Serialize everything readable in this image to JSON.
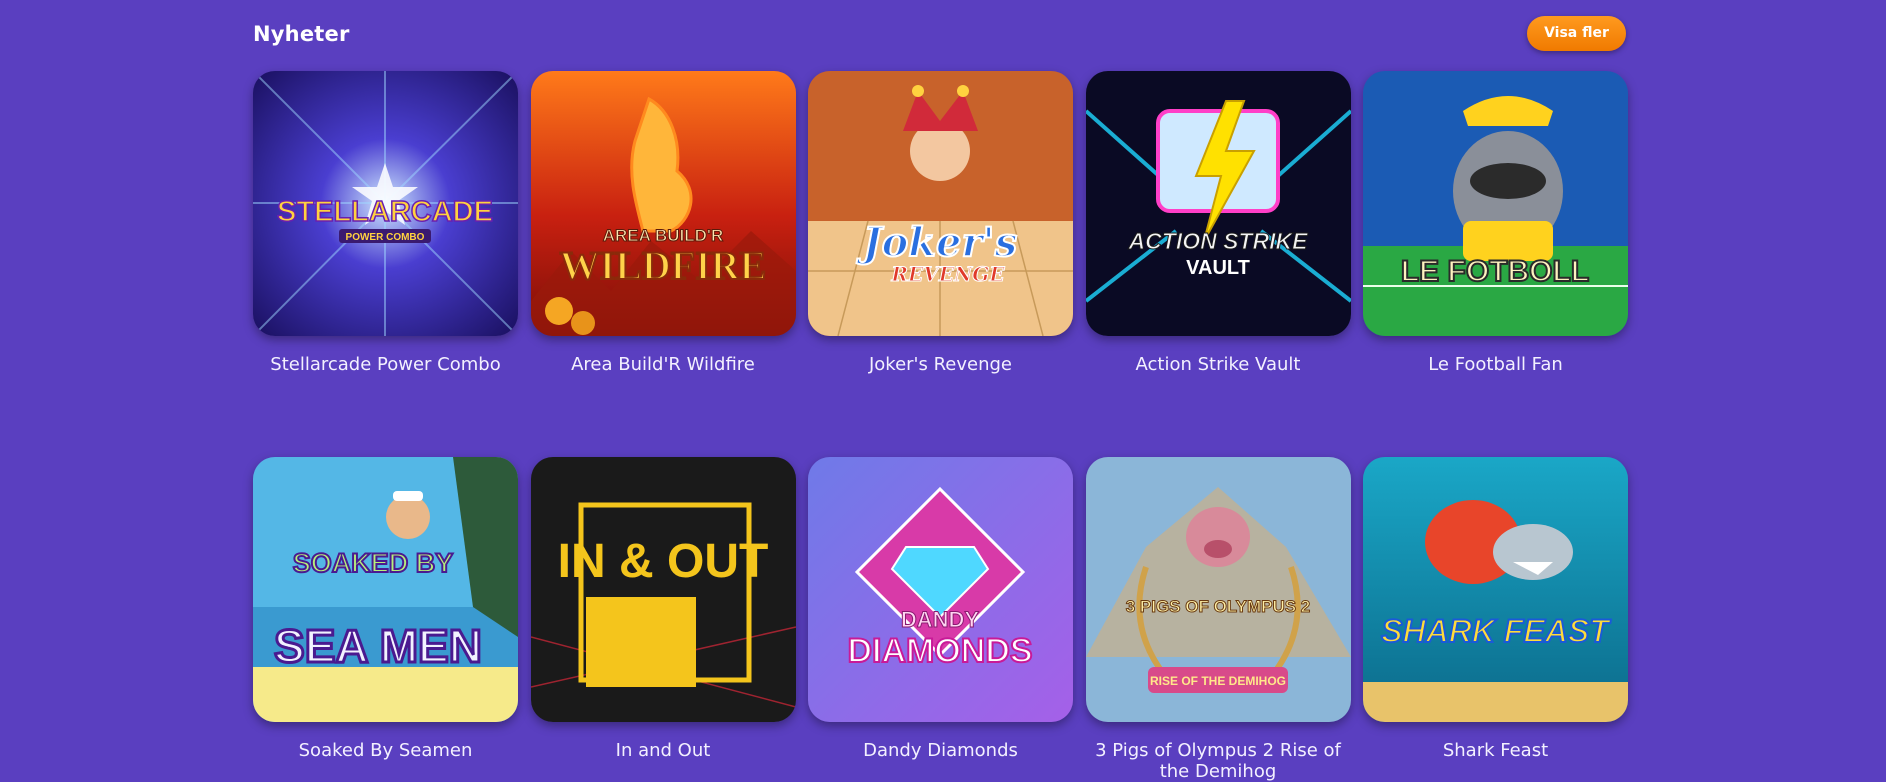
{
  "section": {
    "title": "Nyheter",
    "more_label": "Visa fler"
  },
  "games": [
    {
      "name": "Stellarcade Power Combo",
      "logo": "STELLARCADE",
      "sub": "POWER COMBO",
      "art": "starburst",
      "colors": [
        "#2a1a8a",
        "#8fd0ff",
        "#ffd23f"
      ]
    },
    {
      "name": "Area Build'R Wildfire",
      "logo": "WILDFIRE",
      "sub": "AREA BUILD'R",
      "art": "fire-horse",
      "colors": [
        "#b81f0e",
        "#ff8a1e",
        "#ffd24a"
      ]
    },
    {
      "name": "Joker's Revenge",
      "logo": "Joker's",
      "sub": "REVENGE",
      "art": "joker",
      "colors": [
        "#c8622b",
        "#f6b25a",
        "#1d5fd1"
      ]
    },
    {
      "name": "Action Strike Vault",
      "logo": "ACTION STRIKE",
      "sub": "VAULT",
      "art": "lightning",
      "colors": [
        "#0a0a24",
        "#1fd6ff",
        "#ffe100"
      ]
    },
    {
      "name": "Le Football Fan",
      "logo": "LE FOTBOLL",
      "sub": "",
      "art": "raccoon",
      "colors": [
        "#1b5bb4",
        "#2aa844",
        "#ffd21e"
      ]
    },
    {
      "name": "Soaked By Seamen",
      "logo": "SEA MEN",
      "sub": "SOAKED BY",
      "art": "beach",
      "colors": [
        "#54b7e6",
        "#8a4cd6",
        "#f6ea8a"
      ]
    },
    {
      "name": "In and Out",
      "logo": "IN & OUT",
      "sub": "",
      "art": "in-out",
      "colors": [
        "#1a1a1a",
        "#f4c51c",
        "#d8283a"
      ]
    },
    {
      "name": "Dandy Diamonds",
      "logo": "DIAMONDS",
      "sub": "DANDY",
      "art": "diamond",
      "colors": [
        "#7b46d9",
        "#4fd8ff",
        "#ff4fc8"
      ]
    },
    {
      "name": "3 Pigs of Olympus 2 Rise of the Demihog",
      "logo": "3 PIGS OF OLYMPUS 2",
      "sub": "RISE OF THE DEMIHOG",
      "art": "olympus",
      "colors": [
        "#8bb6d8",
        "#d0a24a",
        "#d84a8a"
      ]
    },
    {
      "name": "Shark Feast",
      "logo": "SHARK FEAST",
      "sub": "",
      "art": "shark",
      "colors": [
        "#1aa7c7",
        "#e8452a",
        "#ffdc3a"
      ]
    }
  ]
}
